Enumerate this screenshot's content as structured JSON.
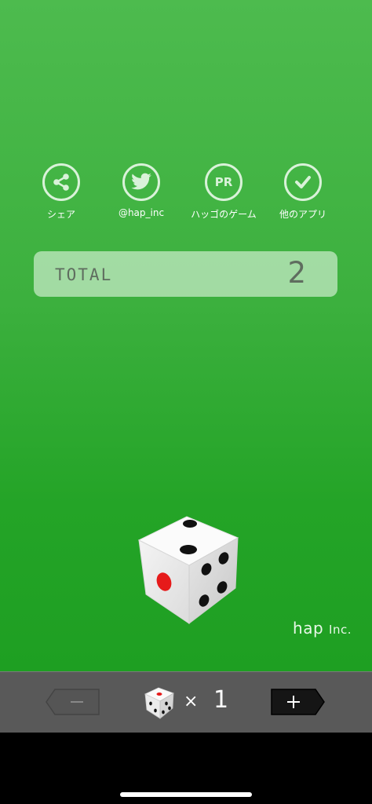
{
  "header_buttons": [
    {
      "label": "シェア",
      "icon": "share-icon"
    },
    {
      "label": "@hap_inc",
      "icon": "twitter-bird-icon"
    },
    {
      "label": "ハッゴのゲーム",
      "icon": "pr-icon",
      "icon_text": "PR"
    },
    {
      "label": "他のアプリ",
      "icon": "check-icon"
    }
  ],
  "total": {
    "label": "TOTAL",
    "value": "2"
  },
  "dice_display": {
    "top_face": 2,
    "left_face": 1,
    "right_face": 4
  },
  "brand": {
    "name": "hap",
    "suffix": "Inc."
  },
  "controls": {
    "minus_label": "−",
    "plus_label": "+",
    "times_symbol": "×",
    "dice_count": "1"
  },
  "colors": {
    "background_top": "#4dbb4e",
    "background_bottom": "#1e9f22",
    "control_bar": "#595959",
    "pip_red": "#e61a1a",
    "pip_black": "#111111"
  }
}
